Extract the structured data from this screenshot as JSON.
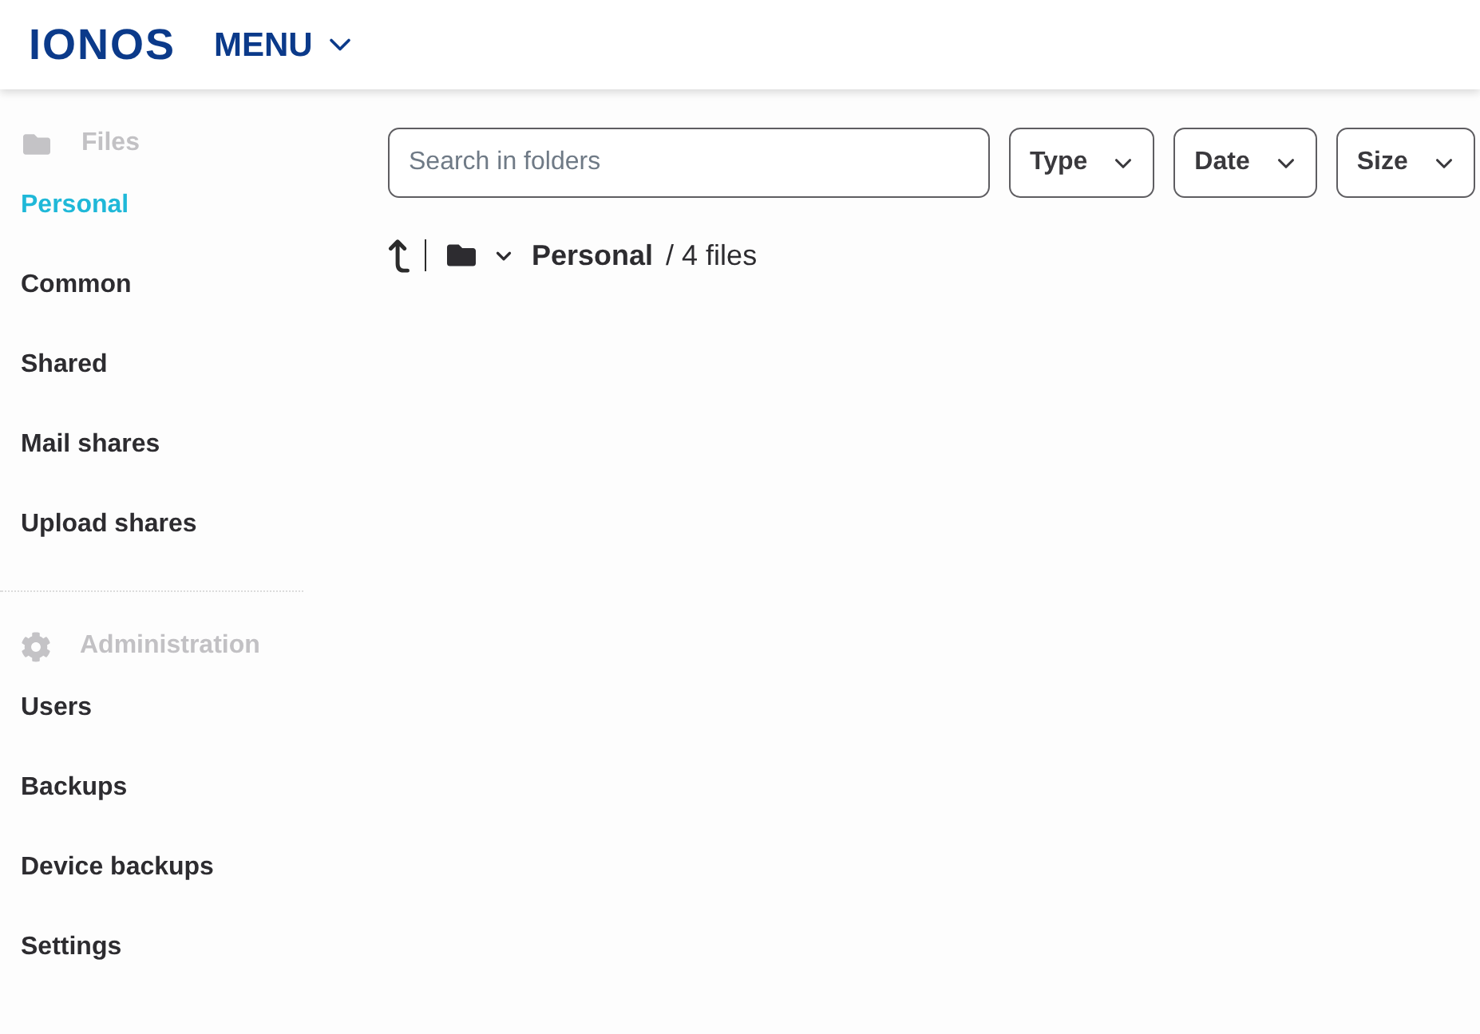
{
  "header": {
    "logo": "IONOS",
    "menu_button": "MENU"
  },
  "sidebar": {
    "sections": [
      {
        "kind": "files",
        "heading": "Files",
        "items": [
          {
            "label": "Personal",
            "selected": true
          },
          {
            "label": "Common",
            "selected": false
          },
          {
            "label": "Shared",
            "selected": false
          },
          {
            "label": "Mail shares",
            "selected": false
          },
          {
            "label": "Upload shares",
            "selected": false
          }
        ]
      },
      {
        "kind": "administration",
        "heading": "Administration",
        "items": [
          {
            "label": "Users",
            "selected": false
          },
          {
            "label": "Backups",
            "selected": false
          },
          {
            "label": "Device backups",
            "selected": false
          },
          {
            "label": "Settings",
            "selected": false
          }
        ]
      }
    ]
  },
  "toolbar": {
    "search": {
      "placeholder": "Search in folders"
    },
    "filters": [
      "Type",
      "Date",
      "Size"
    ]
  },
  "breadcrumb": {
    "folder": "Personal",
    "count": "/ 4 files"
  }
}
